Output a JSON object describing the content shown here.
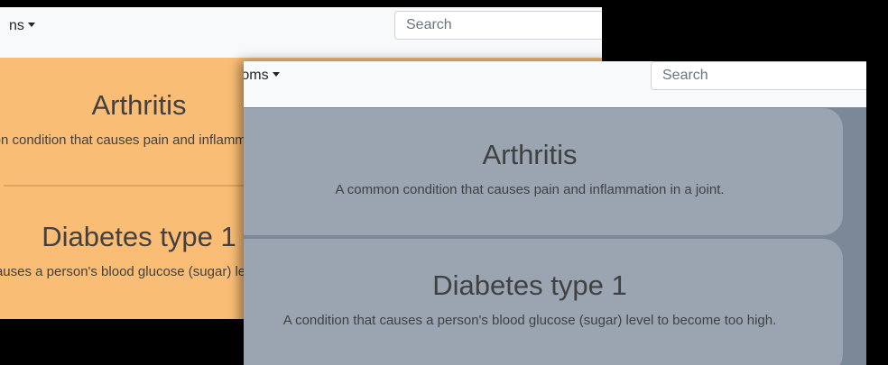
{
  "back_window": {
    "nav_label": "ns",
    "search_placeholder": "Search",
    "cards": [
      {
        "title": "Arthritis",
        "text": "A common condition that causes pain and inflammation in a joint."
      },
      {
        "title": "Diabetes type 1",
        "text": "A condition that causes a person's blood glucose (sugar) level to become too high."
      }
    ]
  },
  "front_window": {
    "nav_label": "ptoms",
    "search_placeholder": "Search",
    "cards": [
      {
        "title": "Arthritis",
        "text": "A common condition that causes pain and inflammation in a joint."
      },
      {
        "title": "Diabetes type 1",
        "text": "A condition that causes a person's blood glucose (sugar) level to become too high."
      }
    ]
  },
  "colors": {
    "back_window_bg": "#fabd76",
    "front_window_bg": "#7b8898",
    "front_card_bg": "#9aa5b1",
    "navbar_bg": "#f8f9fa"
  }
}
